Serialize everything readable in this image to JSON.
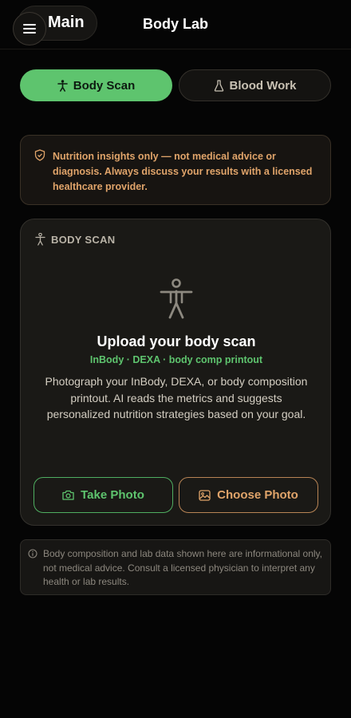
{
  "header": {
    "main_label": "Main",
    "title": "Body Lab",
    "menu_icon": "hamburger-menu-icon"
  },
  "tabs": [
    {
      "label": "Body Scan",
      "icon": "person-icon",
      "active": true
    },
    {
      "label": "Blood Work",
      "icon": "flask-icon",
      "active": false
    }
  ],
  "disclaimer": {
    "icon": "shield-icon",
    "text": "Nutrition insights only — not medical advice or diagnosis. Always discuss your results with a licensed healthcare provider."
  },
  "scan_card": {
    "section_label": "BODY SCAN",
    "section_icon": "person-icon",
    "figure_icon": "body-figure-icon",
    "title": "Upload your body scan",
    "subtitle": "InBody · DEXA · body comp printout",
    "description": "Photograph your InBody, DEXA, or body composition printout. AI reads the metrics and suggests personalized nutrition strategies based on your goal.",
    "take_photo_label": "Take Photo",
    "choose_photo_label": "Choose Photo"
  },
  "footer_note": {
    "icon": "info-icon",
    "text": "Body composition and lab data shown here are informational only, not medical advice. Consult a licensed physician to interpret any health or lab results."
  },
  "colors": {
    "accent_green": "#5ec46e",
    "accent_orange": "#e0a46a",
    "background": "#050505",
    "card": "#1a1916"
  }
}
